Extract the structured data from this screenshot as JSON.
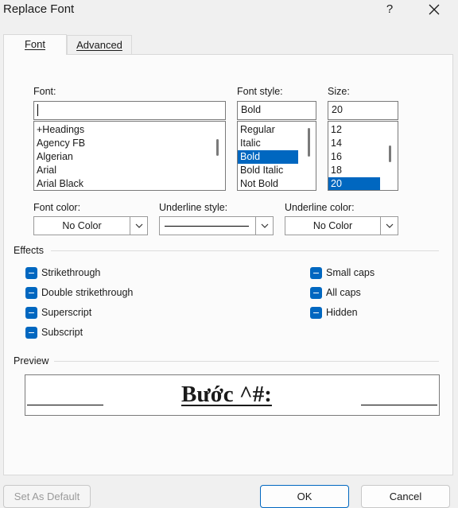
{
  "window": {
    "title": "Replace Font",
    "help_label": "?"
  },
  "tabs": [
    {
      "label": "Font"
    },
    {
      "label": "Advanced"
    }
  ],
  "font": {
    "label": "Font:",
    "value": "",
    "items": [
      "+Headings",
      "Agency FB",
      "Algerian",
      "Arial",
      "Arial Black"
    ]
  },
  "font_style": {
    "label": "Font style:",
    "value": "Bold",
    "items": [
      "Regular",
      "Italic",
      "Bold",
      "Bold Italic",
      "Not Bold"
    ],
    "selected": "Bold"
  },
  "size": {
    "label": "Size:",
    "value": "20",
    "items": [
      "12",
      "14",
      "16",
      "18",
      "20"
    ],
    "selected": "20"
  },
  "font_color": {
    "label": "Font color:",
    "value": "No Color"
  },
  "underline_style": {
    "label": "Underline style:"
  },
  "underline_color": {
    "label": "Underline color:",
    "value": "No Color"
  },
  "effects": {
    "title": "Effects",
    "left": [
      {
        "label": "Strikethrough",
        "state": "indeterminate"
      },
      {
        "label": "Double strikethrough",
        "state": "indeterminate"
      },
      {
        "label": "Superscript",
        "state": "indeterminate"
      },
      {
        "label": "Subscript",
        "state": "indeterminate"
      }
    ],
    "right": [
      {
        "label": "Small caps",
        "state": "indeterminate"
      },
      {
        "label": "All caps",
        "state": "indeterminate"
      },
      {
        "label": "Hidden",
        "state": "indeterminate"
      }
    ]
  },
  "preview": {
    "title": "Preview",
    "text": "Bước ^#:"
  },
  "buttons": {
    "set_default": "Set As Default",
    "ok": "OK",
    "cancel": "Cancel"
  },
  "colors": {
    "accent": "#0067c0",
    "dialog_bg": "#f0f0f0",
    "panel_bg": "#fbfbfb"
  }
}
